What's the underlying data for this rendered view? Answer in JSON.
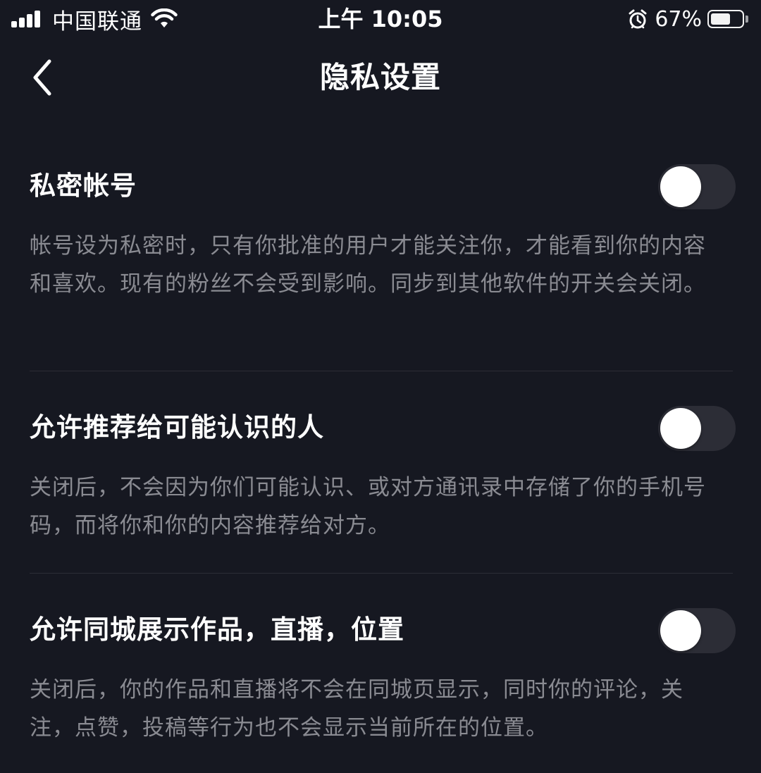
{
  "status_bar": {
    "carrier": "中国联通",
    "time": "上午 10:05",
    "battery_percent_text": "67%",
    "battery_level": 0.67,
    "signal_bars": 4,
    "icons": [
      "signal-icon",
      "wifi-icon",
      "alarm-icon",
      "battery-icon"
    ]
  },
  "nav": {
    "back_icon": "chevron-left-icon",
    "title": "隐私设置"
  },
  "colors": {
    "background": "#161821",
    "title_text": "#ffffff",
    "description_text": "#8a8b92",
    "toggle_track_off": "#2c2d36",
    "toggle_knob": "#ffffff",
    "divider": "#2c2d36"
  },
  "settings": [
    {
      "title": "私密帐号",
      "description": "帐号设为私密时，只有你批准的用户才能关注你，才能看到你的内容和喜欢。现有的粉丝不会受到影响。同步到其他软件的开关会关闭。",
      "enabled": false
    },
    {
      "title": "允许推荐给可能认识的人",
      "description": "关闭后，不会因为你们可能认识、或对方通讯录中存储了你的手机号码，而将你和你的内容推荐给对方。",
      "enabled": false
    },
    {
      "title": "允许同城展示作品，直播，位置",
      "description": "关闭后，你的作品和直播将不会在同城页显示，同时你的评论，关注，点赞，投稿等行为也不会显示当前所在的位置。",
      "enabled": false
    }
  ]
}
